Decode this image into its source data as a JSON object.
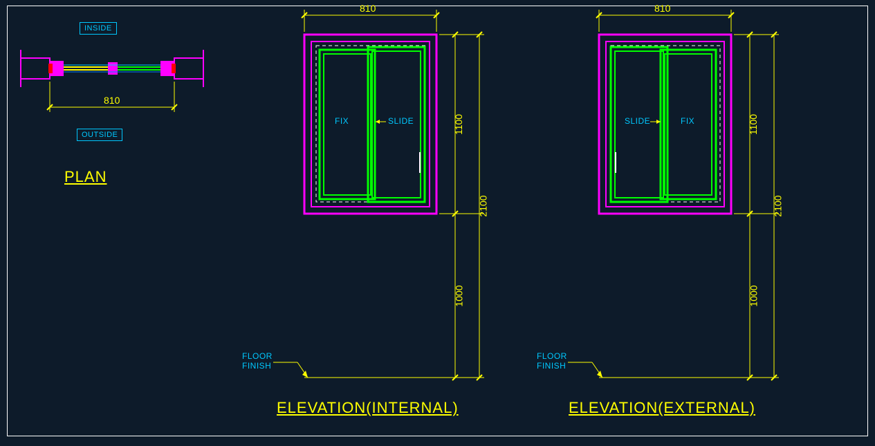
{
  "plan": {
    "title": "PLAN",
    "inside_label": "INSIDE",
    "outside_label": "OUTSIDE",
    "width_dim": "810"
  },
  "elev_internal": {
    "title": "ELEVATION(INTERNAL)",
    "top_dim": "810",
    "dim_upper": "1100",
    "dim_total": "2100",
    "dim_lower": "1000",
    "fix_label": "FIX",
    "slide_label": "SLIDE",
    "floor_label1": "FLOOR",
    "floor_label2": "FINISH"
  },
  "elev_external": {
    "title": "ELEVATION(EXTERNAL)",
    "top_dim": "810",
    "dim_upper": "1100",
    "dim_total": "2100",
    "dim_lower": "1000",
    "fix_label": "FIX",
    "slide_label": "SLIDE",
    "floor_label1": "FLOOR",
    "floor_label2": "FINISH"
  },
  "colors": {
    "magenta": "#ff00ff",
    "green": "#00ff00",
    "yellow": "#ffff00",
    "cyan": "#00c8ff",
    "red": "#ff0000",
    "blue": "#0080ff",
    "white": "#ffffff"
  }
}
